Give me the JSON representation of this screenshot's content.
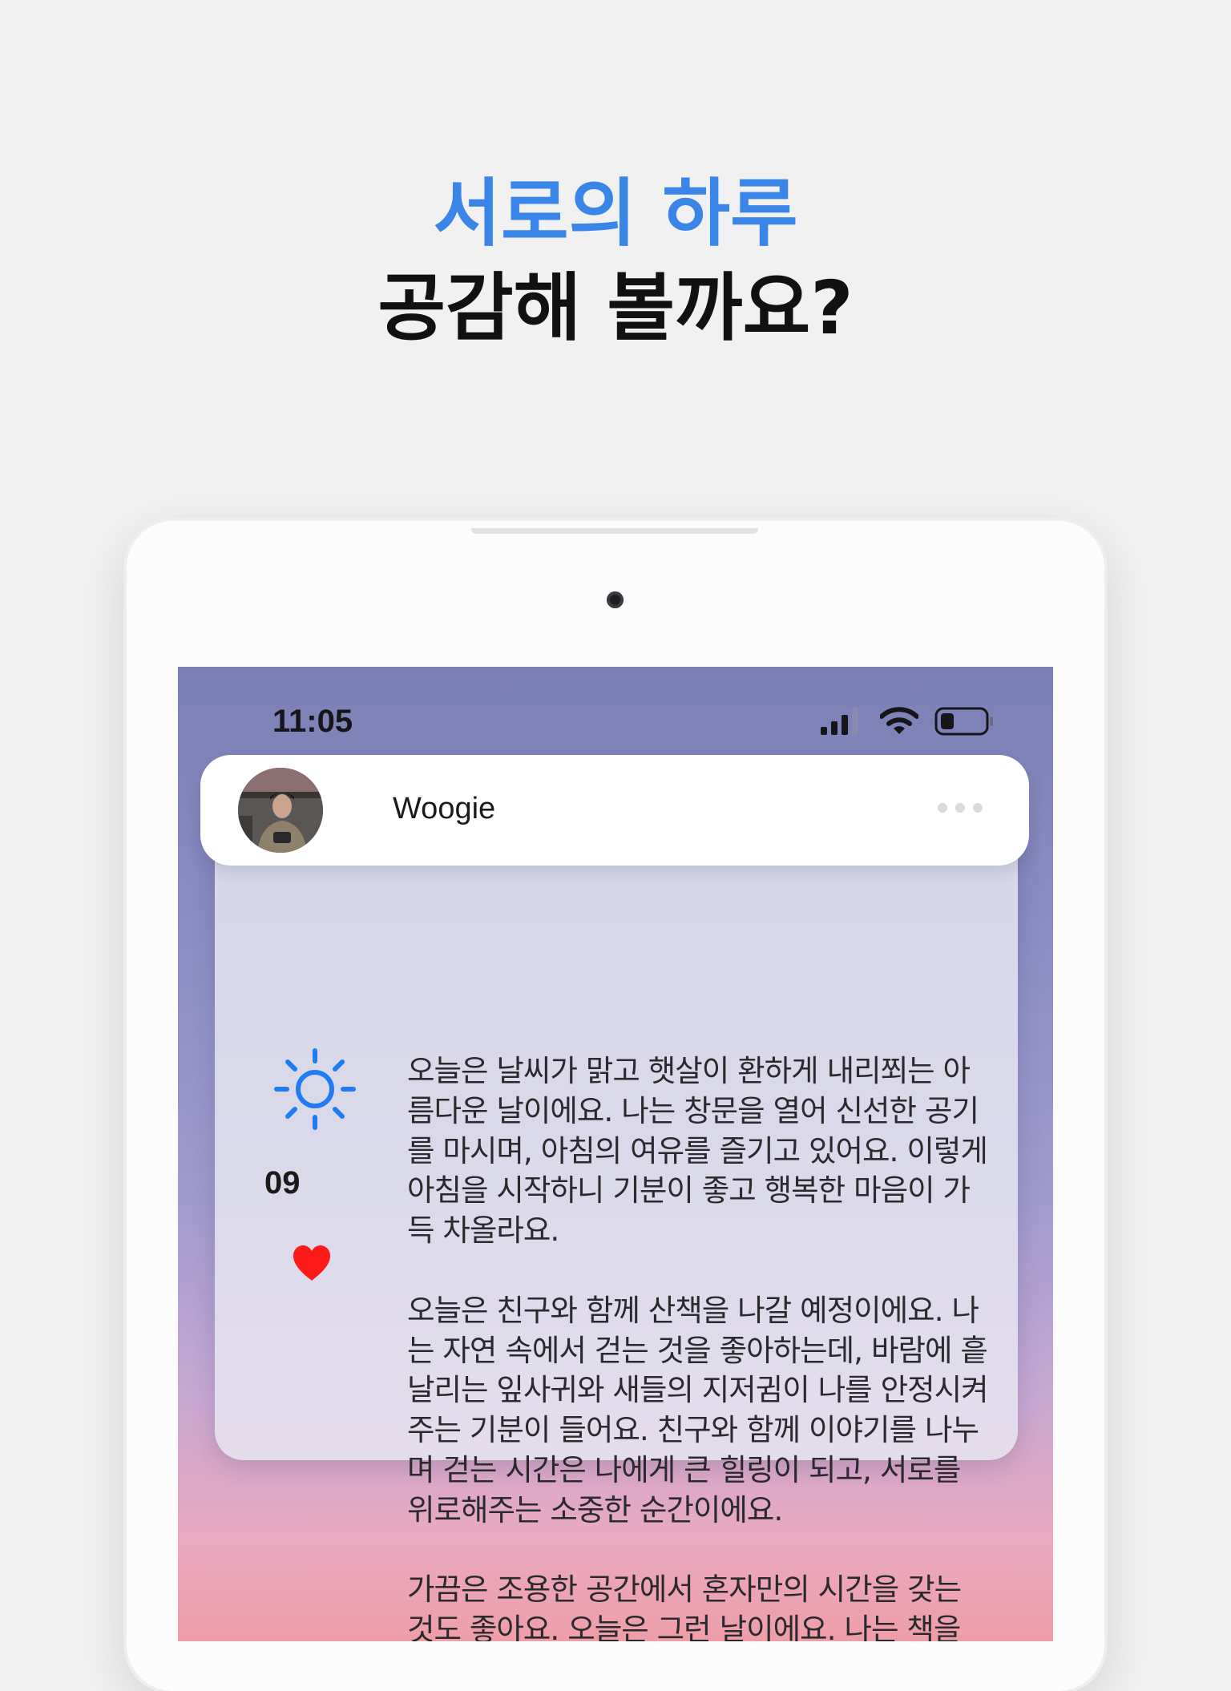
{
  "headline": {
    "accent": "서로의 하루",
    "main": "공감해 볼까요?"
  },
  "status_bar": {
    "time": "11:05",
    "icons": [
      "cellular-signal-icon",
      "wifi-icon",
      "battery-icon"
    ]
  },
  "post": {
    "username": "Woogie",
    "day": "09",
    "weather_icon": "sun-icon",
    "like_icon": "heart-icon",
    "more_icon": "more-dots-icon",
    "paragraphs": [
      "오늘은 날씨가 맑고 햇살이 환하게 내리쬐는 아\n름다운 날이에요. 나는 창문을 열어 신선한 공기\n를 마시며, 아침의 여유를 즐기고 있어요. 이렇게\n아침을 시작하니 기분이 좋고 행복한 마음이 가\n득 차올라요.",
      "오늘은 친구와 함께 산책을 나갈 예정이에요. 나\n는 자연 속에서 걷는 것을 좋아하는데, 바람에 흩\n날리는 잎사귀와 새들의 지저귐이 나를 안정시켜\n주는 기분이 들어요. 친구와 함께 이야기를 나누\n며 걷는 시간은 나에게 큰 힐링이 되고, 서로를\n위로해주는 소중한 순간이에요.",
      "가끔은 조용한 공간에서 혼자만의 시간을 갖는\n것도 좋아요. 오늘은 그런 날이에요. 나는 책을\n읽으며 자유롭게 마음을 여행시키고, 소중한..."
    ]
  },
  "colors": {
    "accent": "#3a86e8",
    "heart": "#ff1a1a",
    "sun": "#1f7cf2"
  }
}
